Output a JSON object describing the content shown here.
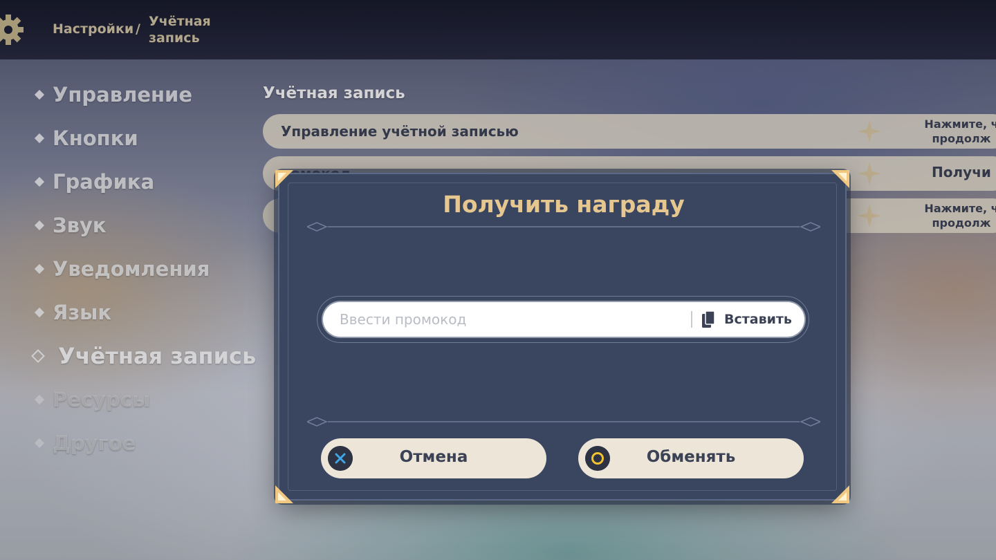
{
  "breadcrumb": {
    "root": "Настройки",
    "separator": "/",
    "current": "Учётная запись"
  },
  "menu": {
    "items": [
      {
        "label": "Управление"
      },
      {
        "label": "Кнопки"
      },
      {
        "label": "Графика"
      },
      {
        "label": "Звук"
      },
      {
        "label": "Уведомления"
      },
      {
        "label": "Язык"
      },
      {
        "label": "Учётная запись"
      },
      {
        "label": "Ресурсы"
      },
      {
        "label": "Другое"
      }
    ],
    "active": "Учётная запись"
  },
  "section": {
    "title": "Учётная запись",
    "rows": [
      {
        "label": "Управление учётной записью",
        "action": "Нажмите, ч продолж"
      },
      {
        "label": "ромокод",
        "action": "Получи"
      },
      {
        "label": "",
        "action": "Нажмите, ч продолж"
      }
    ]
  },
  "dialog": {
    "title": "Получить награду",
    "input_placeholder": "Ввести промокод",
    "input_value": "",
    "paste_label": "Вставить",
    "cancel_label": "Отмена",
    "confirm_label": "Обменять"
  },
  "colors": {
    "dialog_bg": "#3a4560",
    "title_gold": "#e7c790",
    "button_bg": "#ece5d8",
    "text_dark": "#3b4255",
    "cancel_icon_blue": "#3fa6e8",
    "confirm_icon_yellow": "#f2c230"
  },
  "icons": {
    "top_left": "gear-icon",
    "paste": "clipboard-icon",
    "cancel": "cross-icon",
    "confirm": "circle-icon"
  }
}
